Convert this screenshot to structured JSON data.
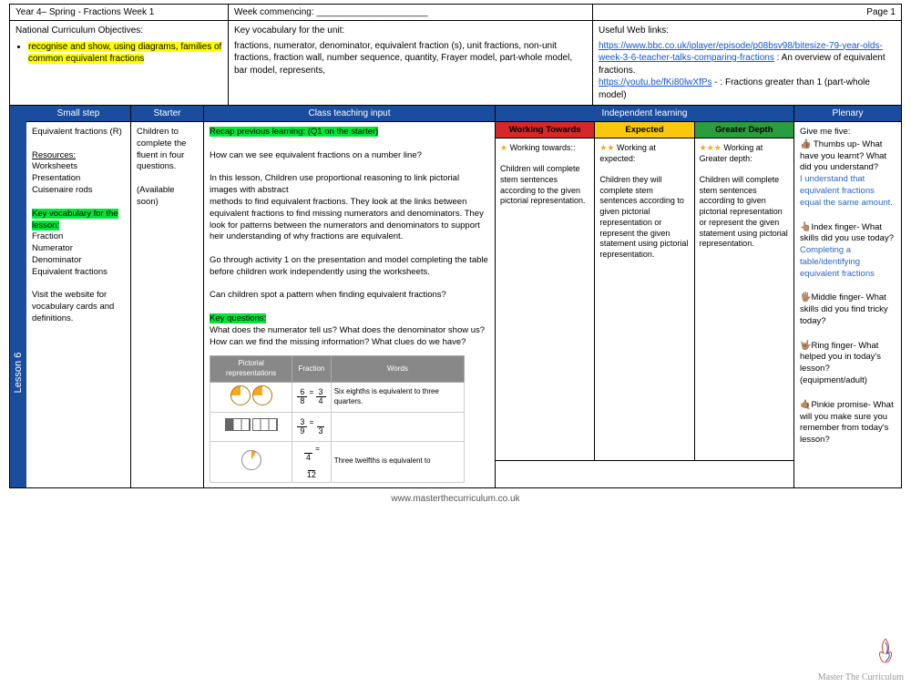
{
  "top": {
    "title": "Year 4– Spring - Fractions Week 1",
    "week": "Week commencing: ______________________",
    "page": "Page 1"
  },
  "info": {
    "nco_title": "National Curriculum Objectives:",
    "nco_text": "recognise and show, using diagrams, families of common equivalent fractions",
    "vocab_title": "Key vocabulary for the unit:",
    "vocab_text": "fractions, numerator, denominator, equivalent fraction (s), unit fractions, non-unit fractions, fraction wall, number sequence, quantity, Frayer model, part-whole model, bar model, represents,",
    "links_title": "Useful Web links:",
    "link1": "https://www.bbc.co.uk/iplayer/episode/p08bsv98/bitesize-79-year-olds-week-3-6-teacher-talks-comparing-fractions",
    "link1_desc": " : An overview of equivalent fractions.",
    "link2": "https://youtu.be/fKi80lwXfPs",
    "link2_desc": " - : Fractions greater than 1 (part-whole model)"
  },
  "lesson_label": "Lesson 6",
  "headers": {
    "small": "Small step",
    "starter": "Starter",
    "input": "Class teaching input",
    "indep": "Independent learning",
    "plenary": "Plenary"
  },
  "small": {
    "step": "Equivalent fractions (R)",
    "res_head": "Resources:",
    "res": "Worksheets\nPresentation\nCuisenaire rods",
    "kv_head": "Key vocabulary for the lesson:",
    "kv": "Fraction\nNumerator\nDenominator\nEquivalent fractions",
    "visit": "Visit the website for vocabulary cards and definitions."
  },
  "starter": {
    "text": "Children to complete the fluent in four questions.",
    "avail": "(Available soon)"
  },
  "input": {
    "recap": "Recap previous learning: (Q1 on the starter)",
    "q1": "How can we see equivalent fractions on a number line?",
    "p1": "In this lesson, Children use proportional reasoning to link pictorial   images with abstract",
    "p2": "methods to find equivalent fractions. They look at the links between equivalent fractions to find missing numerators and denominators. They look for patterns between the numerators and denominators to support heir understanding of why fractions are equivalent.",
    "p3": "Go through activity 1 on the presentation and model completing the table before children work independently  using the worksheets.",
    "q2": "Can children spot a pattern when finding equivalent fractions?",
    "kq_head": "Key questions:",
    "kq": "What does the numerator tell us? What does the denominator show us? How can we find the missing information? What clues do we have?",
    "t_h1": "Pictorial representations",
    "t_h2": "Fraction",
    "t_h3": "Words",
    "r1_words": "Six eighths is equivalent to three quarters.",
    "r3_words": "Three twelfths is equivalent to"
  },
  "indep": {
    "wt_head": "Working Towards",
    "ex_head": "Expected",
    "gd_head": "Greater Depth",
    "wt_label": "Working towards::",
    "wt_text": "Children will complete stem sentences according to the given pictorial representation.",
    "ex_label": "Working at expected:",
    "ex_text": "Children they will complete stem sentences according to given pictorial representation or represent the given statement using pictorial representation.",
    "gd_label": "Working at Greater depth:",
    "gd_text": "Children will complete stem sentences according to given pictorial representation or represent the given statement using pictorial representation."
  },
  "plenary": {
    "title": "Give me five:",
    "thumbs": "Thumbs up- What have you learnt? What did you understand?",
    "thumbs_ans": "I understand that equivalent fractions equal the same amount.",
    "index": "Index finger- What skills did you use today?",
    "index_ans": "Completing a table/identifying equivalent fractions",
    "middle": "Middle finger- What skills did you find tricky today?",
    "ring": "Ring finger- What helped you in today's lesson? (equipment/adult)",
    "pinkie": "Pinkie promise- What will you make sure you remember from today's lesson?"
  },
  "footer": "www.masterthecurriculum.co.uk",
  "brand": "Master The Curriculum"
}
